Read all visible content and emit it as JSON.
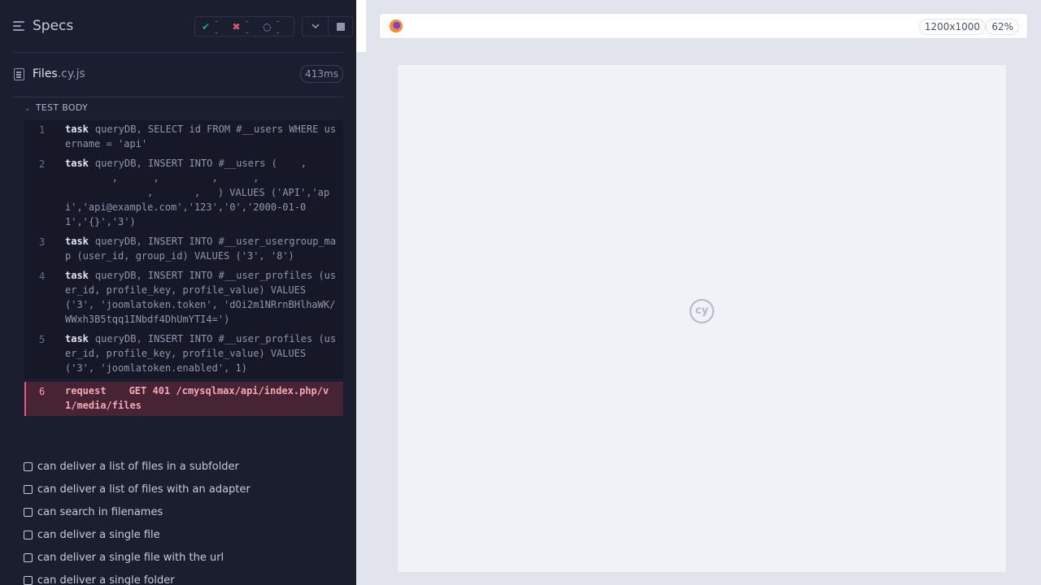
{
  "header": {
    "title": "Specs",
    "passed": "--",
    "failed": "--",
    "pending": "--"
  },
  "file": {
    "name": "Files",
    "ext": ".cy.js",
    "duration": "413ms"
  },
  "test_body": {
    "label": "TEST BODY",
    "commands": [
      {
        "num": "1",
        "name": "task",
        "message": "queryDB, SELECT id FROM #__users WHERE username = 'api'"
      },
      {
        "num": "2",
        "name": "task",
        "message": "queryDB, INSERT INTO #__users (    ,\n        ,      ,         ,      ,\n              ,       ,   ) VALUES ('API','api','api@example.com','123','0','2000-01-01','{}','3')"
      },
      {
        "num": "3",
        "name": "task",
        "message": "queryDB, INSERT INTO #__user_usergroup_map (user_id, group_id) VALUES ('3', '8')"
      },
      {
        "num": "4",
        "name": "task",
        "message": "queryDB, INSERT INTO #__user_profiles (user_id, profile_key, profile_value) VALUES ('3', 'joomlatoken.token', 'dOi2m1NRrnBHlhaWK/WWxh3B5tqq1INbdf4DhUmYTI4=')"
      },
      {
        "num": "5",
        "name": "task",
        "message": "queryDB, INSERT INTO #__user_profiles (user_id, profile_key, profile_value) VALUES ('3', 'joomlatoken.enabled', 1)"
      },
      {
        "num": "6",
        "name": "request",
        "message": "GET 401 /cmysqlmax/api/index.php/v1/media/files",
        "status": "failed"
      }
    ]
  },
  "tests": [
    "can deliver a list of files in a subfolder",
    "can deliver a list of files with an adapter",
    "can search in filenames",
    "can deliver a single file",
    "can deliver a single file with the url",
    "can deliver a single folder"
  ],
  "aut": {
    "viewport_size": "1200x1000",
    "zoom": "62%",
    "logo_text": "cy"
  },
  "colors": {
    "reporter_bg": "#1b1e2e",
    "failed_bg": "#462434",
    "failed_accent": "#e05a70",
    "pass_green": "#1fa971",
    "fail_red": "#e45770"
  }
}
